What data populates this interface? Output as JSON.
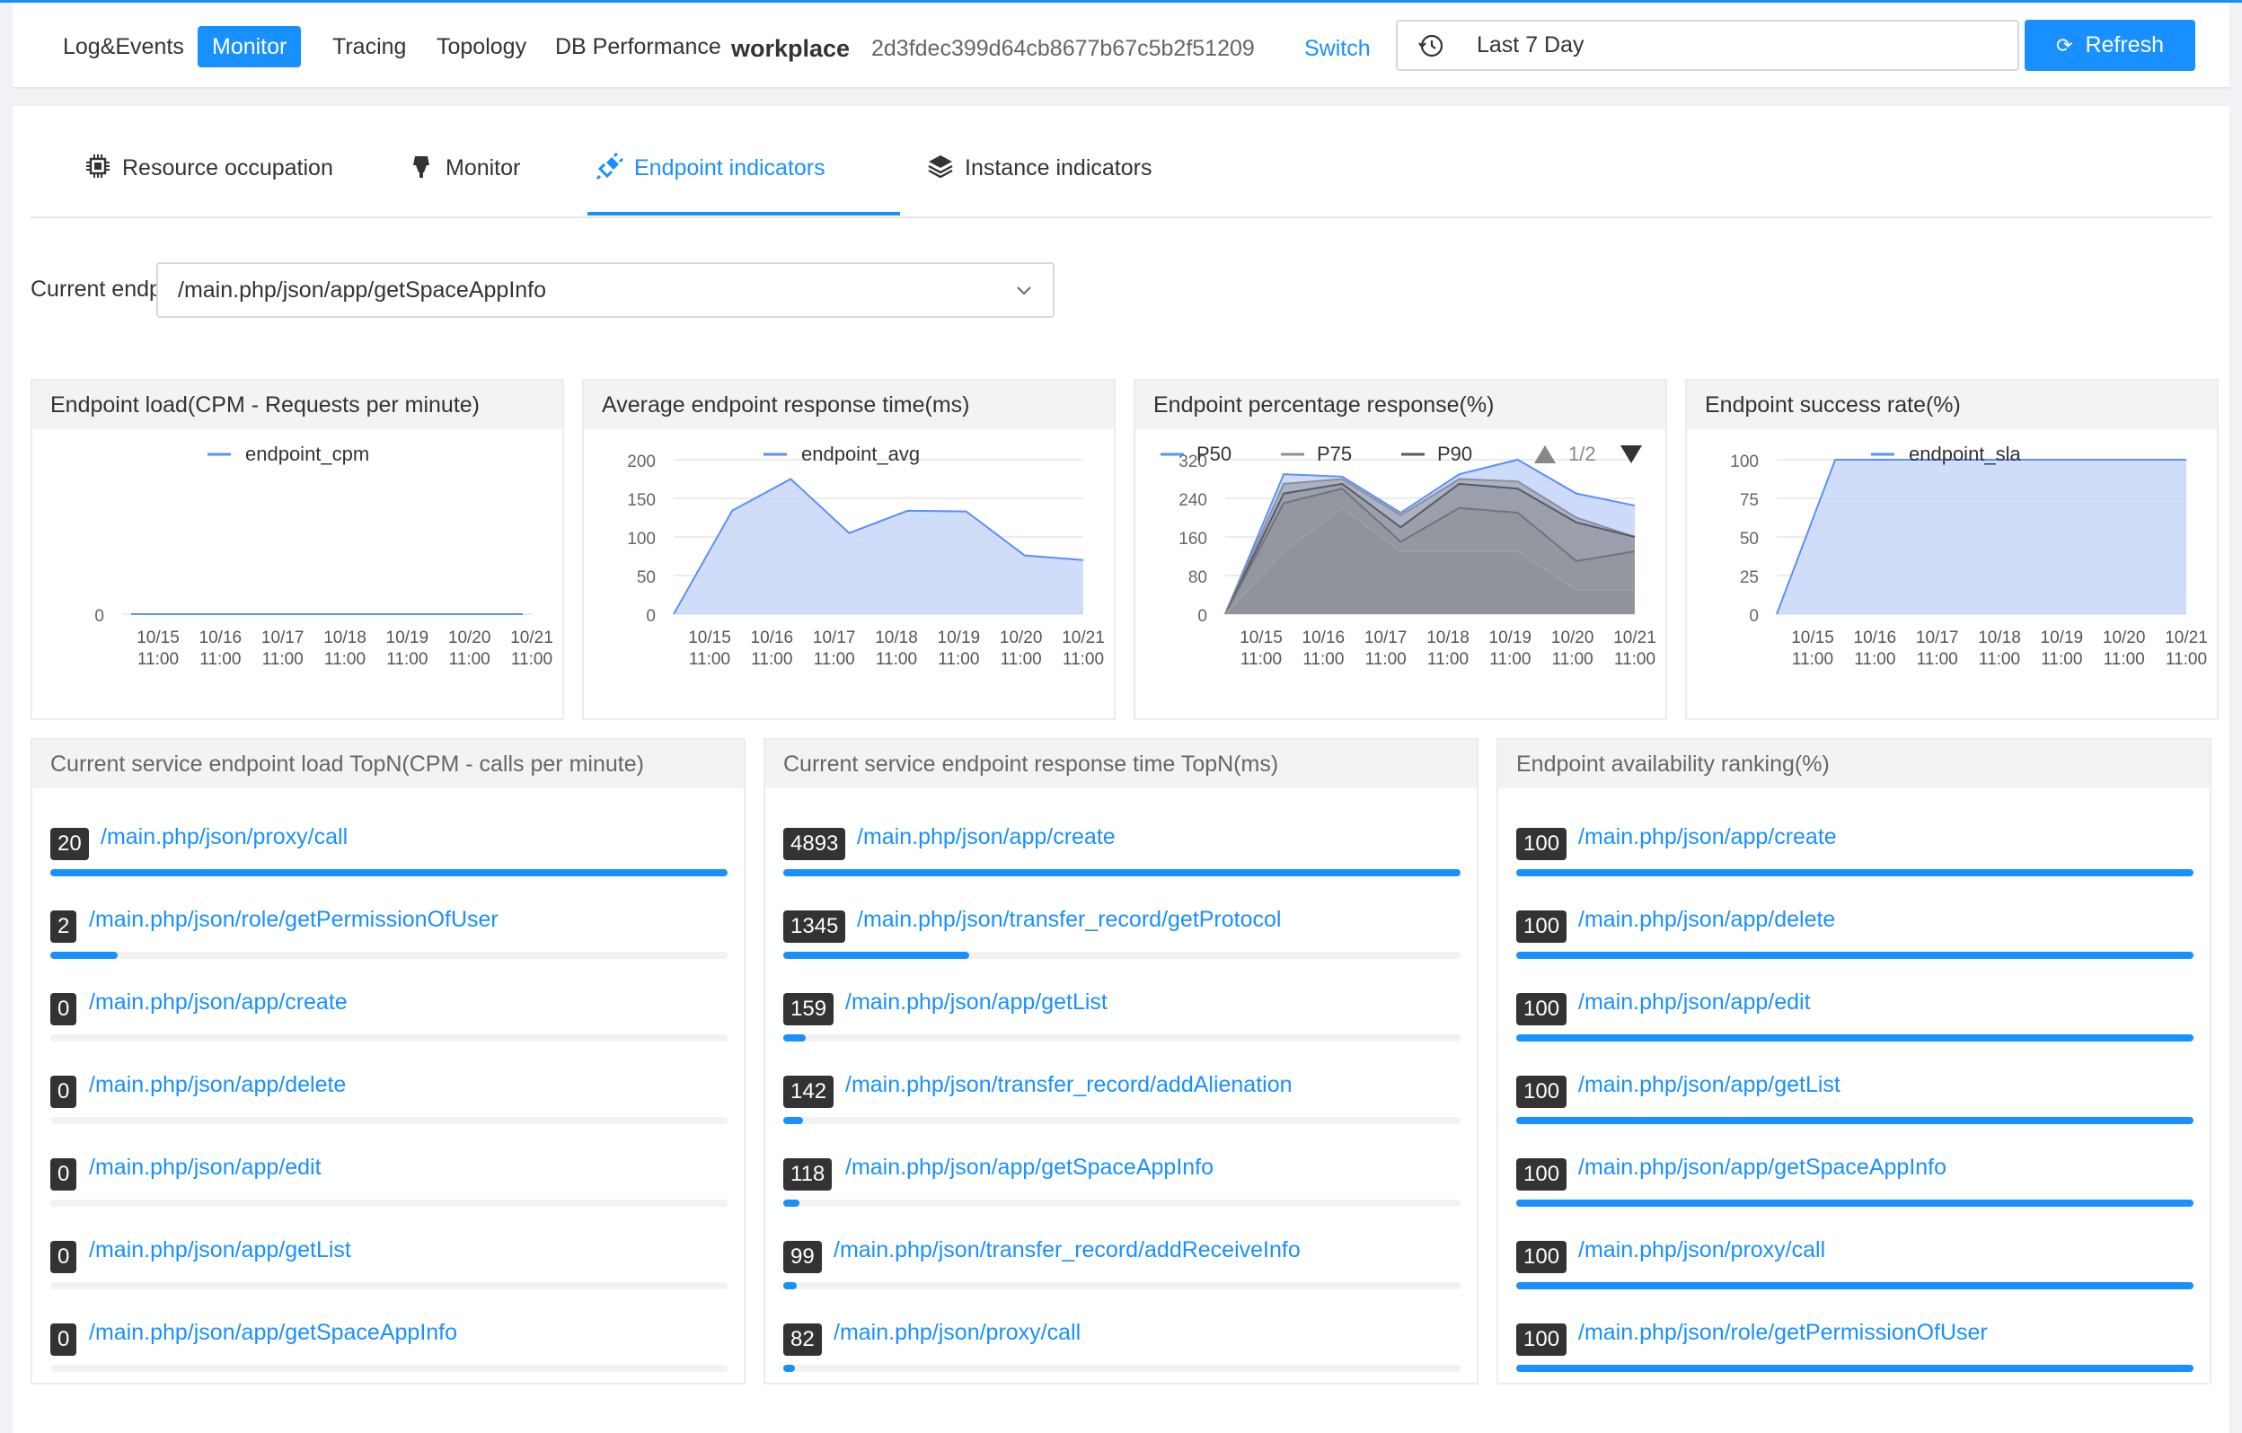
{
  "nav": {
    "items": [
      "Log&Events",
      "Monitor",
      "Tracing",
      "Topology",
      "DB Performance"
    ],
    "active": "Monitor",
    "workplace": "workplace",
    "service_id": "2d3fdec399d64cb8677b67c5b2f51209",
    "switch_label": "Switch",
    "date_range": "Last 7 Day",
    "refresh_label": "Refresh"
  },
  "tabs": {
    "items": [
      {
        "label": "Resource occupation",
        "icon": "chip-icon"
      },
      {
        "label": "Monitor",
        "icon": "gauge-icon"
      },
      {
        "label": "Endpoint indicators",
        "icon": "plug-icon"
      },
      {
        "label": "Instance indicators",
        "icon": "layers-icon"
      }
    ],
    "active": "Endpoint indicators"
  },
  "endpoint_select": {
    "label": "Current endpoint",
    "value": "/main.php/json/app/getSpaceAppInfo"
  },
  "colors": {
    "accent": "#1890ff",
    "series_blue": "#5b8ff9",
    "area_blue": "#c7d7f8",
    "badge": "#333333"
  },
  "chart_data": [
    {
      "type": "line",
      "title": "Endpoint load(CPM - Requests per minute)",
      "x": [
        "10/15 11:00",
        "10/16 11:00",
        "10/17 11:00",
        "10/18 11:00",
        "10/19 11:00",
        "10/20 11:00",
        "10/21 11:00"
      ],
      "series": [
        {
          "name": "endpoint_cpm",
          "values": [
            0,
            0,
            0,
            0,
            0,
            0,
            0
          ]
        }
      ],
      "yticks": [
        0
      ],
      "legend": "top-center"
    },
    {
      "type": "area",
      "title": "Average endpoint response time(ms)",
      "x": [
        "10/15 11:00",
        "10/16 11:00",
        "10/17 11:00",
        "10/18 11:00",
        "10/19 11:00",
        "10/20 11:00",
        "10/21 11:00"
      ],
      "series": [
        {
          "name": "endpoint_avg",
          "values": [
            0,
            134,
            175,
            105,
            134,
            133,
            76,
            70
          ]
        }
      ],
      "ylim": [
        0,
        200
      ],
      "yticks": [
        0,
        50,
        100,
        150,
        200
      ],
      "legend": "top-center"
    },
    {
      "type": "area",
      "title": "Endpoint percentage response(%)",
      "x": [
        "10/15 11:00",
        "10/16 11:00",
        "10/17 11:00",
        "10/18 11:00",
        "10/19 11:00",
        "10/20 11:00",
        "10/21 11:00"
      ],
      "series": [
        {
          "name": "P50",
          "values": [
            0,
            290,
            285,
            210,
            290,
            320,
            250,
            225
          ]
        },
        {
          "name": "P75",
          "values": [
            0,
            270,
            280,
            205,
            280,
            275,
            200,
            160
          ]
        },
        {
          "name": "P90",
          "values": [
            0,
            250,
            270,
            180,
            270,
            260,
            190,
            160
          ]
        },
        {
          "name": "",
          "values": [
            0,
            230,
            260,
            150,
            220,
            210,
            110,
            130
          ]
        },
        {
          "name": "",
          "values": [
            0,
            130,
            220,
            130,
            130,
            130,
            50,
            50
          ]
        }
      ],
      "ylim": [
        0,
        320
      ],
      "yticks": [
        0,
        80,
        160,
        240,
        320
      ],
      "legend": "top-left",
      "legend_page": "1/2"
    },
    {
      "type": "area",
      "title": "Endpoint success rate(%)",
      "x": [
        "10/15 11:00",
        "10/16 11:00",
        "10/17 11:00",
        "10/18 11:00",
        "10/19 11:00",
        "10/20 11:00",
        "10/21 11:00"
      ],
      "series": [
        {
          "name": "endpoint_sla",
          "values": [
            0,
            100,
            100,
            100,
            100,
            100,
            100,
            100
          ]
        }
      ],
      "ylim": [
        0,
        100
      ],
      "yticks": [
        0,
        25,
        50,
        75,
        100
      ],
      "legend": "top-center"
    }
  ],
  "rankings": [
    {
      "title": "Current service endpoint load TopN(CPM - calls per minute)",
      "max": 20,
      "rows": [
        {
          "value": "20",
          "path": "/main.php/json/proxy/call"
        },
        {
          "value": "2",
          "path": "/main.php/json/role/getPermissionOfUser"
        },
        {
          "value": "0",
          "path": "/main.php/json/app/create"
        },
        {
          "value": "0",
          "path": "/main.php/json/app/delete"
        },
        {
          "value": "0",
          "path": "/main.php/json/app/edit"
        },
        {
          "value": "0",
          "path": "/main.php/json/app/getList"
        },
        {
          "value": "0",
          "path": "/main.php/json/app/getSpaceAppInfo"
        }
      ]
    },
    {
      "title": "Current service endpoint response time TopN(ms)",
      "max": 4893,
      "rows": [
        {
          "value": "4893",
          "path": "/main.php/json/app/create"
        },
        {
          "value": "1345",
          "path": "/main.php/json/transfer_record/getProtocol"
        },
        {
          "value": "159",
          "path": "/main.php/json/app/getList"
        },
        {
          "value": "142",
          "path": "/main.php/json/transfer_record/addAlienation"
        },
        {
          "value": "118",
          "path": "/main.php/json/app/getSpaceAppInfo"
        },
        {
          "value": "99",
          "path": "/main.php/json/transfer_record/addReceiveInfo"
        },
        {
          "value": "82",
          "path": "/main.php/json/proxy/call"
        }
      ]
    },
    {
      "title": "Endpoint availability ranking(%)",
      "max": 100,
      "rows": [
        {
          "value": "100",
          "path": "/main.php/json/app/create"
        },
        {
          "value": "100",
          "path": "/main.php/json/app/delete"
        },
        {
          "value": "100",
          "path": "/main.php/json/app/edit"
        },
        {
          "value": "100",
          "path": "/main.php/json/app/getList"
        },
        {
          "value": "100",
          "path": "/main.php/json/app/getSpaceAppInfo"
        },
        {
          "value": "100",
          "path": "/main.php/json/proxy/call"
        },
        {
          "value": "100",
          "path": "/main.php/json/role/getPermissionOfUser"
        }
      ]
    }
  ]
}
